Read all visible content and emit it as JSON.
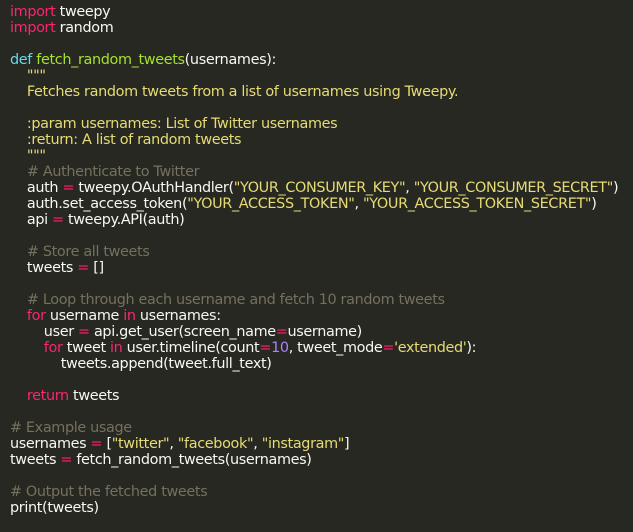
{
  "colors": {
    "background": "#272822",
    "plain": "#f8f8f2",
    "keyword": "#f92672",
    "def": "#66d9ef",
    "function": "#a6e22e",
    "string": "#e6db74",
    "comment": "#75715e",
    "number": "#ae81ff"
  },
  "code": {
    "lines": [
      [
        [
          "kw",
          "import"
        ],
        [
          "plain",
          " tweepy"
        ]
      ],
      [
        [
          "kw",
          "import"
        ],
        [
          "plain",
          " random"
        ]
      ],
      [],
      [
        [
          "def",
          "def"
        ],
        [
          "plain",
          " "
        ],
        [
          "fn",
          "fetch_random_tweets"
        ],
        [
          "plain",
          "(usernames):"
        ]
      ],
      [
        [
          "str",
          "    \"\"\""
        ]
      ],
      [
        [
          "str",
          "    Fetches random tweets from a list of usernames using Tweepy."
        ]
      ],
      [],
      [
        [
          "str",
          "    :param usernames: List of Twitter usernames"
        ]
      ],
      [
        [
          "str",
          "    :return: A list of random tweets"
        ]
      ],
      [
        [
          "str",
          "    \"\"\""
        ]
      ],
      [
        [
          "cmt",
          "    # Authenticate to Twitter"
        ]
      ],
      [
        [
          "plain",
          "    auth "
        ],
        [
          "op",
          "="
        ],
        [
          "plain",
          " tweepy.OAuthHandler("
        ],
        [
          "str",
          "\"YOUR_CONSUMER_KEY\""
        ],
        [
          "plain",
          ", "
        ],
        [
          "str",
          "\"YOUR_CONSUMER_SECRET\""
        ],
        [
          "plain",
          ")"
        ]
      ],
      [
        [
          "plain",
          "    auth.set_access_token("
        ],
        [
          "str",
          "\"YOUR_ACCESS_TOKEN\""
        ],
        [
          "plain",
          ", "
        ],
        [
          "str",
          "\"YOUR_ACCESS_TOKEN_SECRET\""
        ],
        [
          "plain",
          ")"
        ]
      ],
      [
        [
          "plain",
          "    api "
        ],
        [
          "op",
          "="
        ],
        [
          "plain",
          " tweepy.API(auth)"
        ]
      ],
      [],
      [
        [
          "cmt",
          "    # Store all tweets"
        ]
      ],
      [
        [
          "plain",
          "    tweets "
        ],
        [
          "op",
          "="
        ],
        [
          "plain",
          " []"
        ]
      ],
      [],
      [
        [
          "cmt",
          "    # Loop through each username and fetch 10 random tweets"
        ]
      ],
      [
        [
          "kw",
          "    for"
        ],
        [
          "plain",
          " username "
        ],
        [
          "kw",
          "in"
        ],
        [
          "plain",
          " usernames:"
        ]
      ],
      [
        [
          "plain",
          "        user "
        ],
        [
          "op",
          "="
        ],
        [
          "plain",
          " api.get_user(screen_name"
        ],
        [
          "op",
          "="
        ],
        [
          "plain",
          "username)"
        ]
      ],
      [
        [
          "kw",
          "        for"
        ],
        [
          "plain",
          " tweet "
        ],
        [
          "kw",
          "in"
        ],
        [
          "plain",
          " user.timeline(count"
        ],
        [
          "op",
          "="
        ],
        [
          "num",
          "10"
        ],
        [
          "plain",
          ", tweet_mode"
        ],
        [
          "op",
          "="
        ],
        [
          "str",
          "'extended'"
        ],
        [
          "plain",
          "):"
        ]
      ],
      [
        [
          "plain",
          "            tweets.append(tweet.full_text)"
        ]
      ],
      [],
      [
        [
          "kw",
          "    return"
        ],
        [
          "plain",
          " tweets"
        ]
      ],
      [],
      [
        [
          "cmt",
          "# Example usage"
        ]
      ],
      [
        [
          "plain",
          "usernames "
        ],
        [
          "op",
          "="
        ],
        [
          "plain",
          " ["
        ],
        [
          "str",
          "\"twitter\""
        ],
        [
          "plain",
          ", "
        ],
        [
          "str",
          "\"facebook\""
        ],
        [
          "plain",
          ", "
        ],
        [
          "str",
          "\"instagram\""
        ],
        [
          "plain",
          "]"
        ]
      ],
      [
        [
          "plain",
          "tweets "
        ],
        [
          "op",
          "="
        ],
        [
          "plain",
          " fetch_random_tweets(usernames)"
        ]
      ],
      [],
      [
        [
          "cmt",
          "# Output the fetched tweets"
        ]
      ],
      [
        [
          "plain",
          "print(tweets)"
        ]
      ]
    ]
  }
}
